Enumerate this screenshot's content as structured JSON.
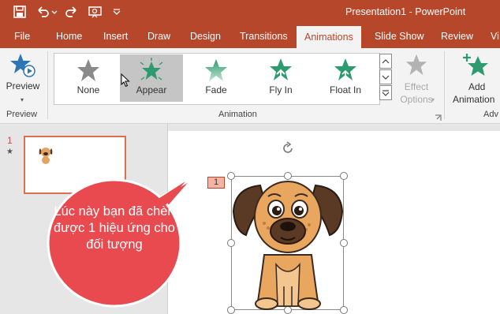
{
  "app": {
    "title": "Presentation1  -  PowerPoint"
  },
  "quick_access": [
    {
      "name": "save-icon"
    },
    {
      "name": "undo-icon"
    },
    {
      "name": "redo-icon"
    },
    {
      "name": "present-icon"
    },
    {
      "name": "customize-icon"
    }
  ],
  "tabs": [
    "File",
    "Home",
    "Insert",
    "Draw",
    "Design",
    "Transitions",
    "Animations",
    "Slide Show",
    "Review",
    "Vi"
  ],
  "active_tab": "Animations",
  "ribbon": {
    "preview_group": {
      "button_label": "Preview",
      "group_label": "Preview"
    },
    "animation_group": {
      "group_label": "Animation",
      "gallery": [
        {
          "label": "None",
          "icon": "star-gray-icon"
        },
        {
          "label": "Appear",
          "icon": "star-burst-icon",
          "selected": true
        },
        {
          "label": "Fade",
          "icon": "star-fade-icon"
        },
        {
          "label": "Fly In",
          "icon": "star-flyin-icon"
        },
        {
          "label": "Float In",
          "icon": "star-floatin-icon"
        }
      ],
      "effect_options_line1": "Effect",
      "effect_options_line2": "Options"
    },
    "advanced_group": {
      "add_line1": "Add",
      "add_line2": "Animation",
      "group_label": "Adv"
    }
  },
  "thumbnails": {
    "slide_number": "1",
    "star": "★"
  },
  "slide": {
    "animation_tag": "1",
    "object": "dog-image"
  },
  "callout": {
    "text": "Lúc này bạn đã chèn được 1 hiệu ứng cho đối tượng"
  },
  "colors": {
    "brand": "#b7472a",
    "callout": "#e84a4f",
    "star_green": "#2e9a6f",
    "star_gray": "#8a8a8a"
  }
}
